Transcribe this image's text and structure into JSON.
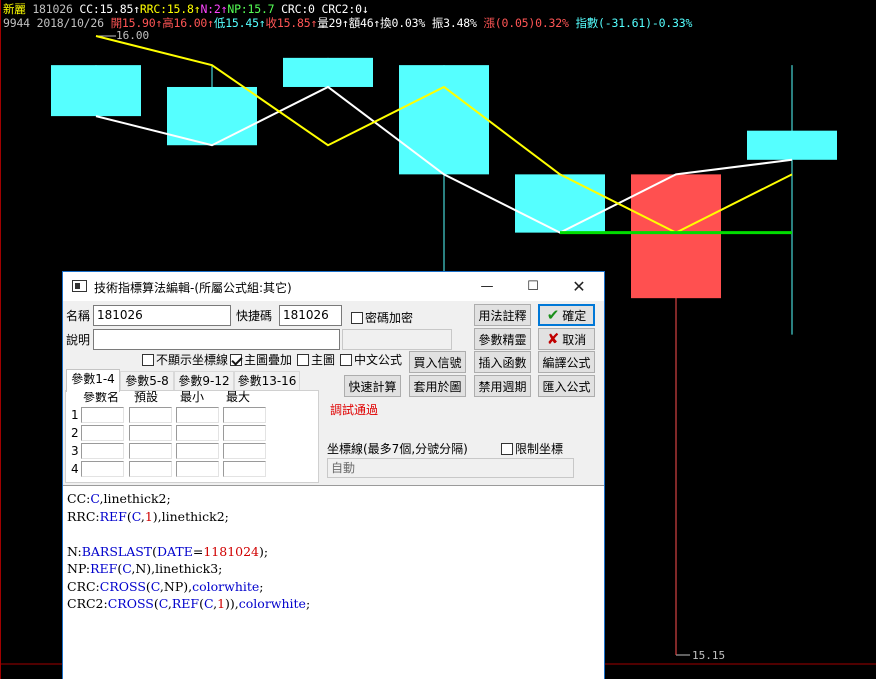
{
  "header": {
    "line1": [
      {
        "text": "新麗",
        "color": "#ffff00"
      },
      {
        "text": " 181026 ",
        "color": "#c0c0c0"
      },
      {
        "text": "CC:15.85↑",
        "color": "#ffffff"
      },
      {
        "text": "RRC:15.8↑",
        "color": "#ffff00"
      },
      {
        "text": "N:2↑",
        "color": "#ff44ff"
      },
      {
        "text": "NP:15.7",
        "color": "#55ff55"
      },
      {
        "text": " CRC:0",
        "color": "#ffffff"
      },
      {
        "text": " CRC2:0↓",
        "color": "#ffffff"
      }
    ],
    "line2": [
      {
        "text": "9944 2018/10/26 ",
        "color": "#c0c0c0"
      },
      {
        "text": "開15.90↑",
        "color": "#ff5555"
      },
      {
        "text": "高16.00↑",
        "color": "#ff5555"
      },
      {
        "text": "低15.45↑",
        "color": "#55ffff"
      },
      {
        "text": "收15.85↑",
        "color": "#ff5555"
      },
      {
        "text": "量29↑",
        "color": "#ffffff"
      },
      {
        "text": "額46↑",
        "color": "#ffffff"
      },
      {
        "text": "換0.03%",
        "color": "#ffffff"
      },
      {
        "text": " 振3.48%",
        "color": "#ffffff"
      },
      {
        "text": " 漲(0.05)0.32%",
        "color": "#ff5555"
      },
      {
        "text": " 指數(-31.61)-0.33%",
        "color": "#55ffff"
      }
    ]
  },
  "chart_data": {
    "type": "candlestick",
    "price_labels": {
      "high": "16.00",
      "low": "15.15"
    },
    "ylim": [
      15.15,
      16.0
    ],
    "candles": [
      {
        "open": 15.96,
        "close": 15.89,
        "high": 15.96,
        "low": 15.89,
        "dir": "down"
      },
      {
        "open": 15.93,
        "close": 15.85,
        "high": 15.96,
        "low": 15.85,
        "dir": "down"
      },
      {
        "open": 15.97,
        "close": 15.93,
        "high": 15.97,
        "low": 15.93,
        "dir": "down"
      },
      {
        "open": 15.96,
        "close": 15.81,
        "high": 15.96,
        "low": 15.56,
        "dir": "down"
      },
      {
        "open": 15.81,
        "close": 15.73,
        "high": 15.81,
        "low": 15.73,
        "dir": "down"
      },
      {
        "open": 15.81,
        "close": 15.64,
        "high": 15.81,
        "low": 15.15,
        "dir": "up"
      },
      {
        "open": 15.87,
        "close": 15.83,
        "high": 15.96,
        "low": 15.59,
        "dir": "down"
      }
    ],
    "series": [
      {
        "name": "CC",
        "color": "#ffffff",
        "values": [
          15.89,
          15.85,
          15.93,
          15.81,
          15.73,
          15.81,
          15.83
        ]
      },
      {
        "name": "RRC",
        "color": "#ffff00",
        "values": [
          16.0,
          15.96,
          15.85,
          15.93,
          15.81,
          15.73,
          15.81
        ]
      },
      {
        "name": "NP",
        "color": "#00dd00",
        "values": [
          null,
          null,
          null,
          null,
          15.73,
          15.73,
          15.73
        ]
      }
    ],
    "colors": {
      "up": "#ff5050",
      "down": "#55ffff",
      "grid": "#a00000"
    }
  },
  "dialog": {
    "title": "技術指標算法編輯-(所屬公式組:其它)",
    "fields": {
      "name_label": "名稱",
      "name_value": "181026",
      "shortcut_label": "快捷碼",
      "shortcut_value": "181026",
      "desc_label": "說明",
      "desc_value": ""
    },
    "checkboxes": {
      "password": {
        "label": "密碼加密",
        "checked": false
      },
      "hide_axis": {
        "label": "不顯示坐標線",
        "checked": false
      },
      "overlay_main": {
        "label": "主圖疊加",
        "checked": true
      },
      "main": {
        "label": "主圖",
        "checked": false
      },
      "chinese": {
        "label": "中文公式",
        "checked": false
      },
      "limit_axis": {
        "label": "限制坐標",
        "checked": false
      }
    },
    "buttons": {
      "usage": "用法註釋",
      "ok": "確定",
      "param_tune": "參數精靈",
      "cancel": "取消",
      "buy_sell": "買入信號",
      "insert_func": "插入函數",
      "compile": "編譯公式",
      "quick_calc": "快速計算",
      "apply_chart": "套用於圖",
      "disable_period": "禁用週期",
      "import": "匯入公式"
    },
    "tabs": [
      "參數1-4",
      "參數5-8",
      "參數9-12",
      "參數13-16"
    ],
    "param_headers": [
      "參數名",
      "預設",
      "最小",
      "最大"
    ],
    "param_rows": [
      "1",
      "2",
      "3",
      "4"
    ],
    "status": "調試通過",
    "axis": {
      "label": "坐標線(最多7個,分號分隔)",
      "value": "自動"
    },
    "code": [
      [
        {
          "t": "CC:"
        },
        {
          "t": "C",
          "c": "kw"
        },
        {
          "t": ",linethick2;"
        }
      ],
      [
        {
          "t": "RRC:"
        },
        {
          "t": "REF",
          "c": "kw"
        },
        {
          "t": "("
        },
        {
          "t": "C",
          "c": "kw"
        },
        {
          "t": ","
        },
        {
          "t": "1",
          "c": "num"
        },
        {
          "t": "),linethick2;"
        }
      ],
      [],
      [
        {
          "t": "N:"
        },
        {
          "t": "BARSLAST",
          "c": "kw"
        },
        {
          "t": "("
        },
        {
          "t": "DATE",
          "c": "kw"
        },
        {
          "t": "="
        },
        {
          "t": "1181024",
          "c": "num"
        },
        {
          "t": ");"
        }
      ],
      [
        {
          "t": "NP:"
        },
        {
          "t": "REF",
          "c": "kw"
        },
        {
          "t": "("
        },
        {
          "t": "C",
          "c": "kw"
        },
        {
          "t": ",N),linethick3;"
        }
      ],
      [
        {
          "t": "CRC:"
        },
        {
          "t": "CROSS",
          "c": "kw"
        },
        {
          "t": "("
        },
        {
          "t": "C",
          "c": "kw"
        },
        {
          "t": ",NP),"
        },
        {
          "t": "colorwhite",
          "c": "kw"
        },
        {
          "t": ";"
        }
      ],
      [
        {
          "t": "CRC2:"
        },
        {
          "t": "CROSS",
          "c": "kw"
        },
        {
          "t": "("
        },
        {
          "t": "C",
          "c": "kw"
        },
        {
          "t": ","
        },
        {
          "t": "REF",
          "c": "kw"
        },
        {
          "t": "("
        },
        {
          "t": "C",
          "c": "kw"
        },
        {
          "t": ","
        },
        {
          "t": "1",
          "c": "num"
        },
        {
          "t": ")),"
        },
        {
          "t": "colorwhite",
          "c": "kw"
        },
        {
          "t": ";"
        }
      ]
    ]
  }
}
